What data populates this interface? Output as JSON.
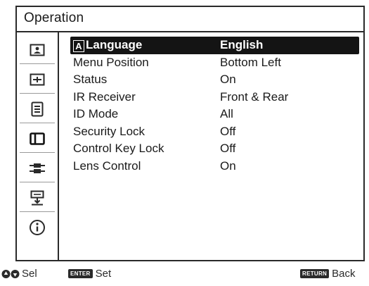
{
  "window": {
    "title": "Operation"
  },
  "sidebar": {
    "items": [
      {
        "icon": "picture-icon",
        "active": false
      },
      {
        "icon": "screen-icon",
        "active": false
      },
      {
        "icon": "setup-icon",
        "active": false
      },
      {
        "icon": "function-icon",
        "active": true
      },
      {
        "icon": "connection-icon",
        "active": false
      },
      {
        "icon": "installation-icon",
        "active": false
      },
      {
        "icon": "information-icon",
        "active": false
      }
    ]
  },
  "menu": {
    "selected_index": 0,
    "language_glyph": "A",
    "items": [
      {
        "label": "Language",
        "value": "English"
      },
      {
        "label": "Menu Position",
        "value": "Bottom Left"
      },
      {
        "label": "Status",
        "value": "On"
      },
      {
        "label": "IR Receiver",
        "value": "Front & Rear"
      },
      {
        "label": "ID Mode",
        "value": "All"
      },
      {
        "label": "Security Lock",
        "value": "Off"
      },
      {
        "label": "Control Key Lock",
        "value": "Off"
      },
      {
        "label": "Lens Control",
        "value": "On"
      }
    ]
  },
  "footer": {
    "select_label": "Sel",
    "enter_badge": "ENTER",
    "set_label": "Set",
    "return_badge": "RETURN",
    "back_label": "Back"
  }
}
